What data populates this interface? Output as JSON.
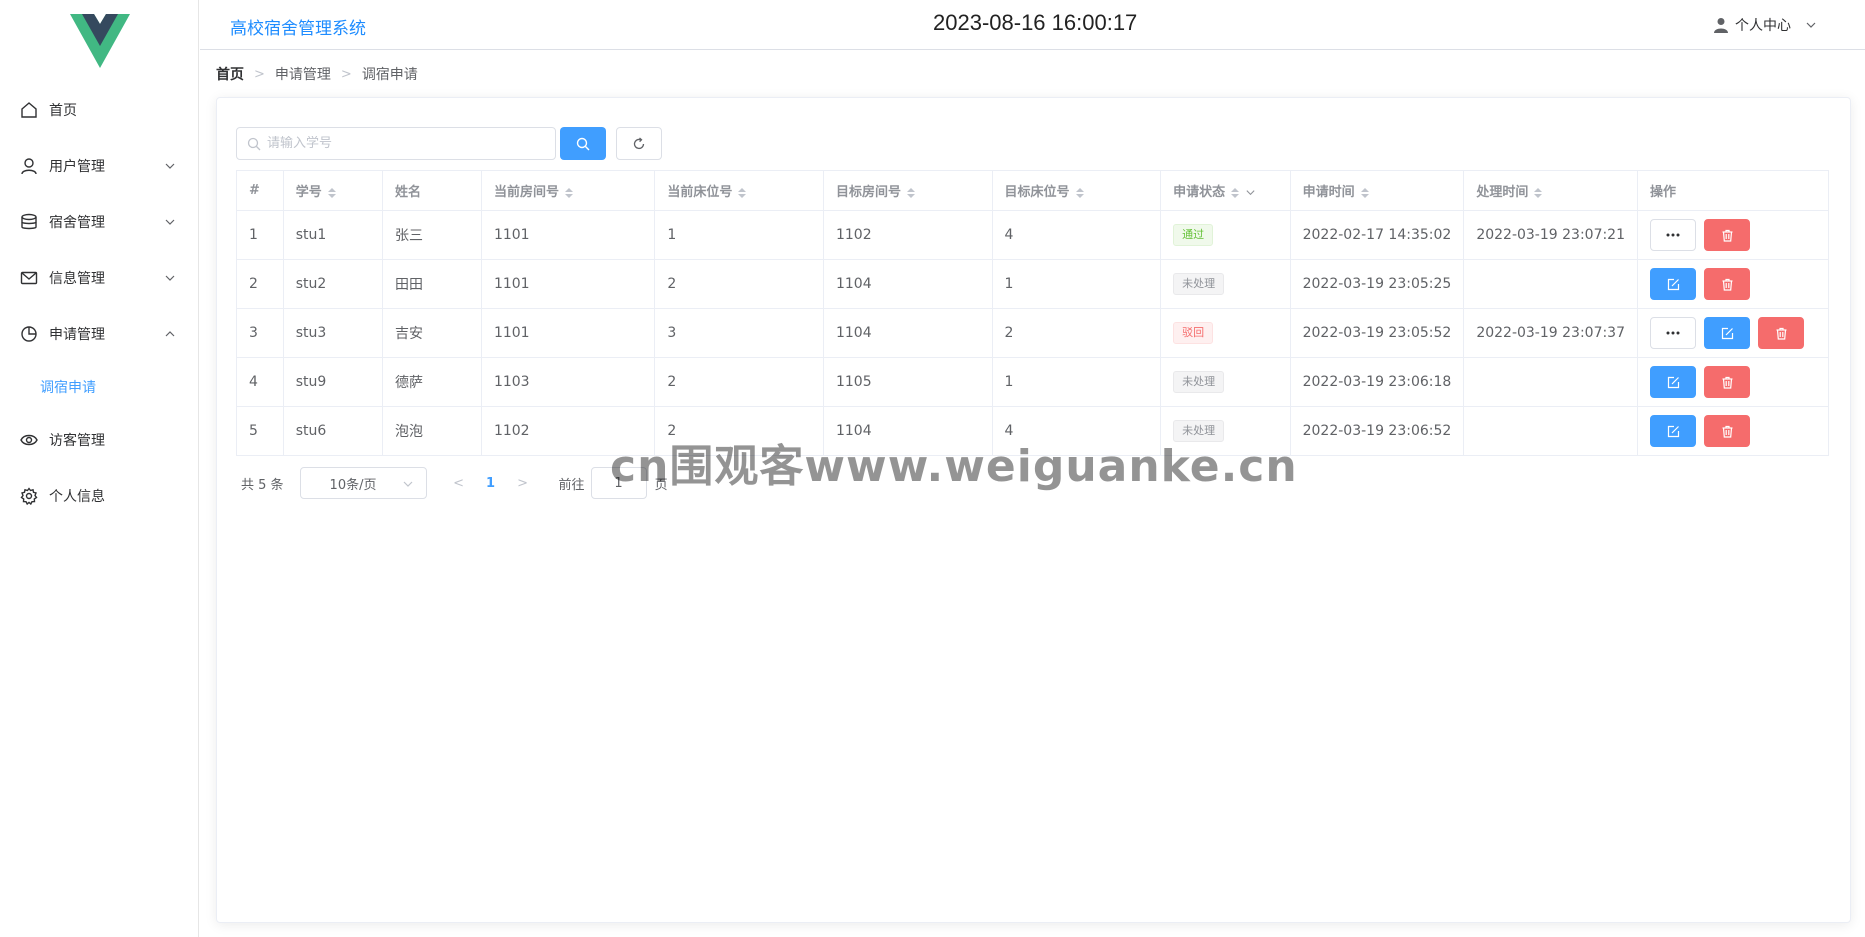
{
  "header": {
    "app_title": "高校宿舍管理系统",
    "clock": "2023-08-16 16:00:17",
    "user_menu_label": "个人中心"
  },
  "sidebar": {
    "items": [
      {
        "label": "首页",
        "icon": "home-icon"
      },
      {
        "label": "用户管理",
        "icon": "user-icon",
        "arrow": "chevron-down"
      },
      {
        "label": "宿舍管理",
        "icon": "database-icon",
        "arrow": "chevron-down"
      },
      {
        "label": "信息管理",
        "icon": "mail-icon",
        "arrow": "chevron-down"
      },
      {
        "label": "申请管理",
        "icon": "pie-chart-icon",
        "arrow": "chevron-up"
      },
      {
        "label": "访客管理",
        "icon": "eye-icon"
      },
      {
        "label": "个人信息",
        "icon": "gear-icon"
      }
    ],
    "submenu_active": "调宿申请"
  },
  "breadcrumb": [
    "首页",
    "申请管理",
    "调宿申请"
  ],
  "search": {
    "placeholder": "请输入学号",
    "value": ""
  },
  "table": {
    "columns": [
      "#",
      "学号",
      "姓名",
      "当前房间号",
      "当前床位号",
      "目标房间号",
      "目标床位号",
      "申请状态",
      "申请时间",
      "处理时间",
      "操作"
    ],
    "rows": [
      {
        "no": "1",
        "sid": "stu1",
        "name": "张三",
        "cur_room": "1101",
        "cur_bed": "1",
        "tgt_room": "1102",
        "tgt_bed": "4",
        "status": "通过",
        "status_type": "success",
        "apply_time": "2022-02-17 14:35:02",
        "handle_time": "2022-03-19 23:07:21",
        "actions": [
          "more",
          "delete"
        ]
      },
      {
        "no": "2",
        "sid": "stu2",
        "name": "田田",
        "cur_room": "1101",
        "cur_bed": "2",
        "tgt_room": "1104",
        "tgt_bed": "1",
        "status": "未处理",
        "status_type": "info",
        "apply_time": "2022-03-19 23:05:25",
        "handle_time": "",
        "actions": [
          "edit",
          "delete"
        ]
      },
      {
        "no": "3",
        "sid": "stu3",
        "name": "吉安",
        "cur_room": "1101",
        "cur_bed": "3",
        "tgt_room": "1104",
        "tgt_bed": "2",
        "status": "驳回",
        "status_type": "danger",
        "apply_time": "2022-03-19 23:05:52",
        "handle_time": "2022-03-19 23:07:37",
        "actions": [
          "more",
          "edit",
          "delete"
        ]
      },
      {
        "no": "4",
        "sid": "stu9",
        "name": "德萨",
        "cur_room": "1103",
        "cur_bed": "2",
        "tgt_room": "1105",
        "tgt_bed": "1",
        "status": "未处理",
        "status_type": "info",
        "apply_time": "2022-03-19 23:06:18",
        "handle_time": "",
        "actions": [
          "edit",
          "delete"
        ]
      },
      {
        "no": "5",
        "sid": "stu6",
        "name": "泡泡",
        "cur_room": "1102",
        "cur_bed": "2",
        "tgt_room": "1104",
        "tgt_bed": "4",
        "status": "未处理",
        "status_type": "info",
        "apply_time": "2022-03-19 23:06:52",
        "handle_time": "",
        "actions": [
          "edit",
          "delete"
        ]
      }
    ]
  },
  "pagination": {
    "total_text": "共 5 条",
    "page_size": "10条/页",
    "current_page": "1",
    "goto_label": "前往",
    "jumper_value": "1",
    "page_unit": "页"
  },
  "watermark": "cn围观客www.weiguanke.cn",
  "colors": {
    "primary": "#409eff",
    "danger": "#f56c6c",
    "success": "#67c23a",
    "title_blue": "#1e8cff",
    "logo_green": "#41b883",
    "logo_dark": "#35495e"
  }
}
